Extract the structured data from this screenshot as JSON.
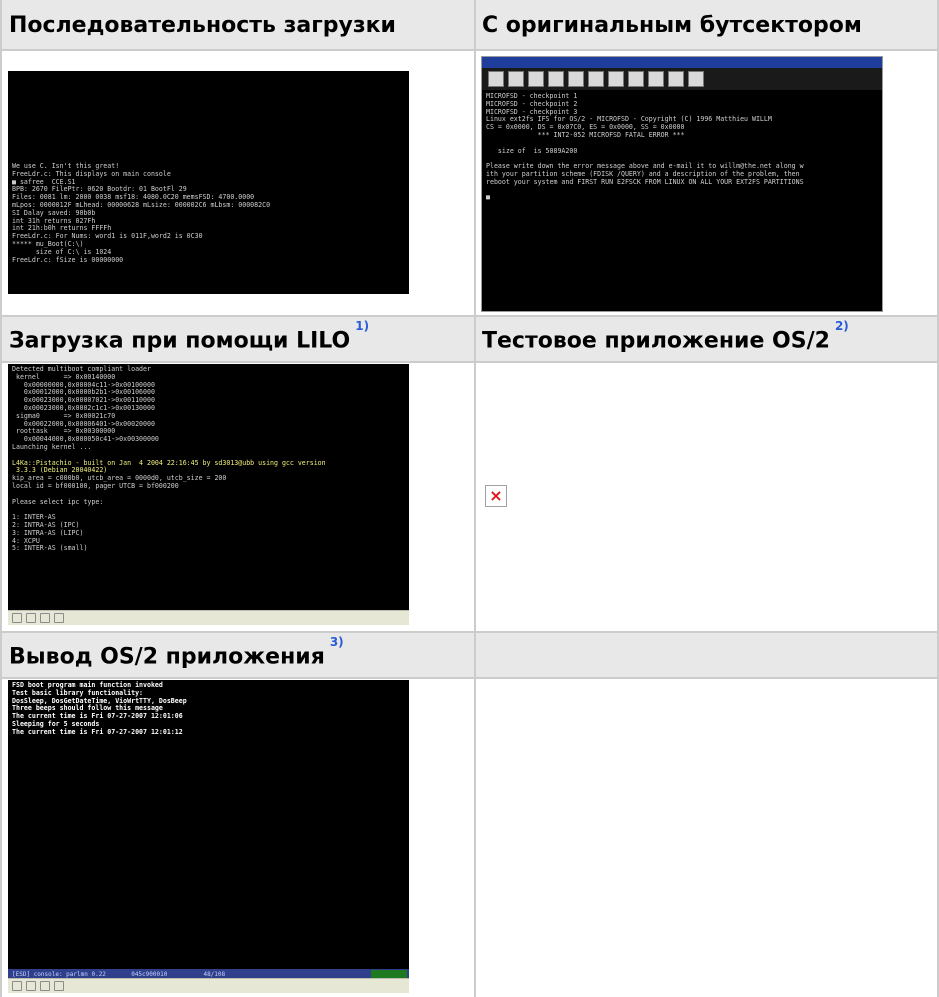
{
  "headers": {
    "row1_col1": "Последовательность загрузки",
    "row1_col2": "С оригинальным бутсектором",
    "row2_col1": "Загрузка при помощи LILO",
    "row2_col2": "Тестовое приложение OS/2",
    "row3_col1": "Вывод OS/2 приложения"
  },
  "footnotes": {
    "row2_col1": "1)",
    "row2_col2": "2)",
    "row3_col1": "3)"
  },
  "broken_image_glyph": "×",
  "colors": {
    "header_bg": "#e8e8e8",
    "border": "#cccccc",
    "footnote": "#2b5bd6"
  }
}
